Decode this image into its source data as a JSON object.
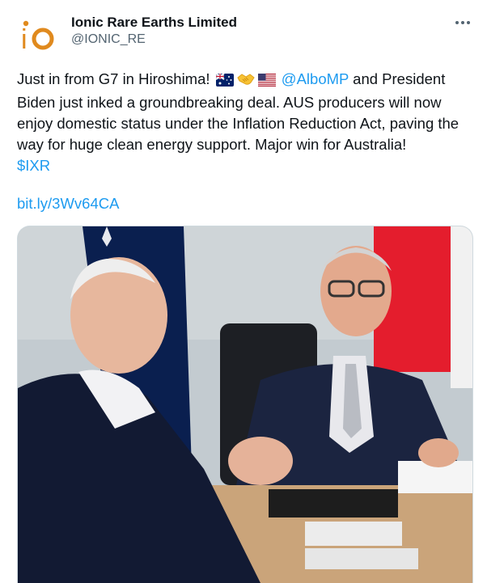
{
  "account": {
    "display_name": "Ionic Rare Earths Limited",
    "handle": "@IONIC_RE",
    "avatar_text": "io"
  },
  "tweet": {
    "text_part1": "Just in from G7 in Hiroshima!",
    "mention": "@AlboMP",
    "text_part2": " and President Biden just inked a groundbreaking deal. AUS producers will now enjoy domestic status under the Inflation Reduction Act, paving the way for huge clean energy support. Major win for Australia!",
    "cashtag": "$IXR",
    "link": "bit.ly/3Wv64CA",
    "emojis": [
      "flag-australia-icon",
      "handshake-icon",
      "flag-usa-icon"
    ]
  },
  "colors": {
    "link": "#1d9bf0",
    "text": "#0f1419",
    "secondary": "#536471",
    "brand_orange": "#e08a1e"
  },
  "media": {
    "description_icon": "photo-image"
  }
}
